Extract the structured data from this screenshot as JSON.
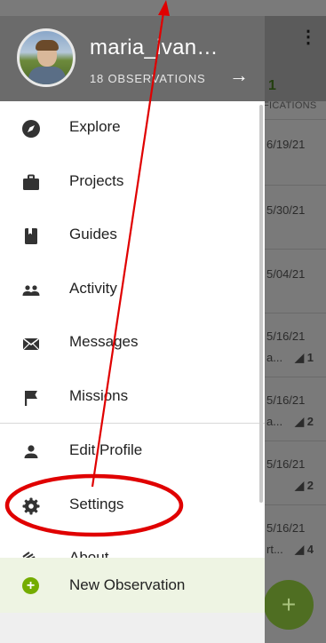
{
  "background": {
    "kebab": "⋮",
    "count": "1",
    "notifications_label": "FICATIONS",
    "rows": [
      {
        "date": "6/19/21",
        "sub": "",
        "badge": ""
      },
      {
        "date": "5/30/21",
        "sub": "",
        "badge": ""
      },
      {
        "date": "5/04/21",
        "sub": "",
        "badge": ""
      },
      {
        "date": "5/16/21",
        "sub": "a...",
        "badge": "1"
      },
      {
        "date": "5/16/21",
        "sub": "a...",
        "badge": "2"
      },
      {
        "date": "5/16/21",
        "sub": "",
        "badge": "2"
      },
      {
        "date": "5/16/21",
        "sub": "rt...",
        "badge": "4"
      }
    ],
    "fab_label": "+"
  },
  "drawer": {
    "username": "maria_ivan…",
    "observations": "18 OBSERVATIONS",
    "arrow": "→",
    "menu": [
      {
        "label": "Explore",
        "icon": "compass-icon"
      },
      {
        "label": "Projects",
        "icon": "briefcase-icon"
      },
      {
        "label": "Guides",
        "icon": "book-icon"
      },
      {
        "label": "Activity",
        "icon": "people-icon"
      },
      {
        "label": "Messages",
        "icon": "envelope-icon"
      },
      {
        "label": "Missions",
        "icon": "flag-icon"
      },
      {
        "label": "Edit Profile",
        "icon": "person-icon"
      },
      {
        "label": "Settings",
        "icon": "gear-icon"
      },
      {
        "label": "About",
        "icon": "info-icon"
      }
    ],
    "new_observation": "New Observation"
  },
  "colors": {
    "accent_green": "#74ac00",
    "annotation_red": "#e00000"
  }
}
